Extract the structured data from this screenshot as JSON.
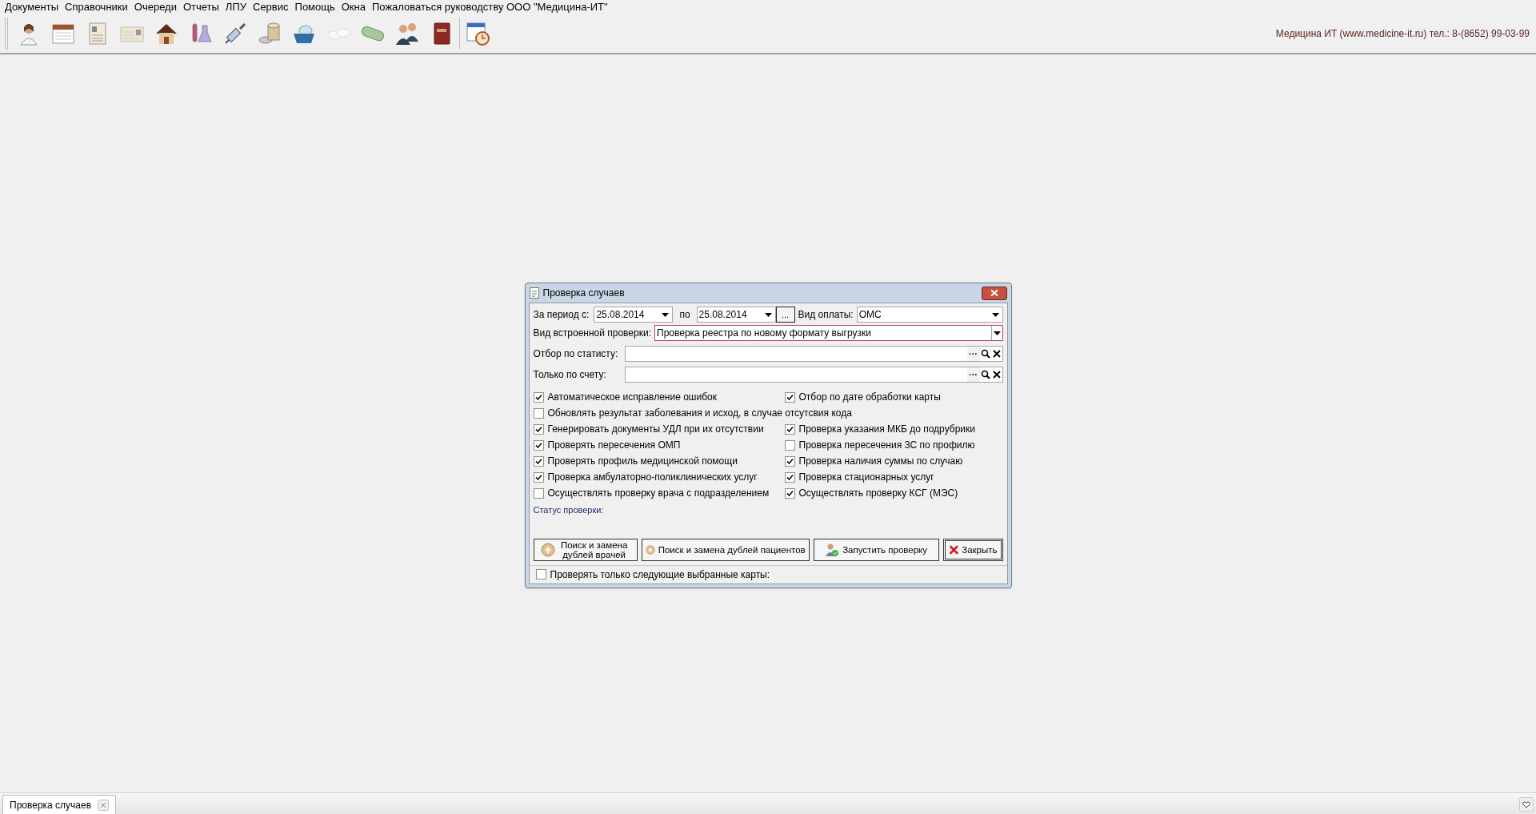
{
  "menu": [
    "Документы",
    "Справочники",
    "Очереди",
    "Отчеты",
    "ЛПУ",
    "Сервис",
    "Помощь",
    "Окна",
    "Пожаловаться руководству ООО \"Медицина-ИТ\""
  ],
  "contact_info": "Медицина ИТ (www.medicine-it.ru) тел.: 8-(8652) 99-03-99",
  "dialog": {
    "title": "Проверка случаев",
    "period_label": "За период с:",
    "date_from": "25.08.2014",
    "to_label": "по",
    "date_to": "25.08.2014",
    "range_button": "...",
    "payment_label": "Вид оплаты:",
    "payment_value": "ОМС",
    "check_type_label": "Вид встроенной проверки:",
    "check_type_value": "Проверка реестра по новому формату выгрузки",
    "check_type_highlighted": true,
    "lookups": [
      {
        "label": "Отбор по статисту:",
        "more": "···"
      },
      {
        "label": "Только по счету:",
        "more": "···"
      }
    ],
    "option_rows": [
      [
        {
          "label": "Автоматическое исправление ошибок",
          "checked": true
        },
        {
          "label": "Отбор по дате обработки карты",
          "checked": true
        }
      ],
      [
        {
          "label": "Обновлять результат заболевания и исход, в случае отсутсвия кода",
          "checked": false
        }
      ],
      [
        {
          "label": "Генерировать документы УДЛ при их отсутствии",
          "checked": true
        },
        {
          "label": "Проверка указания МКБ до подрубрики",
          "checked": true
        }
      ],
      [
        {
          "label": "Проверять пересечения ОМП",
          "checked": true
        },
        {
          "label": "Проверка пересечения ЗС по профилю",
          "checked": false
        }
      ],
      [
        {
          "label": "Проверять профиль медицинской помощи",
          "checked": true
        },
        {
          "label": "Проверка наличия суммы по случаю",
          "checked": true
        }
      ],
      [
        {
          "label": "Проверка амбулаторно-поликлинических услуг",
          "checked": true
        },
        {
          "label": "Проверка стационарных услуг",
          "checked": true
        }
      ],
      [
        {
          "label": "Осуществлять проверку врача с подразделением",
          "checked": false
        },
        {
          "label": "Осуществлять проверку КСГ (МЭС)",
          "checked": true
        }
      ]
    ],
    "status_label": "Статус проверки:",
    "buttons": [
      {
        "kind": "swap",
        "label": "Поиск и замена дублей врачей",
        "default": false
      },
      {
        "kind": "swap",
        "label": "Поиск и замена дублей пациентов",
        "default": false
      },
      {
        "kind": "run",
        "label": "Запустить проверку",
        "default": false
      },
      {
        "kind": "close",
        "label": "Закрыть",
        "default": true
      }
    ],
    "selected_only": {
      "label": "Проверять только следующие выбранные карты:",
      "checked": false
    }
  },
  "taskbar": [
    {
      "label": "Проверка случаев",
      "selected": true
    }
  ]
}
